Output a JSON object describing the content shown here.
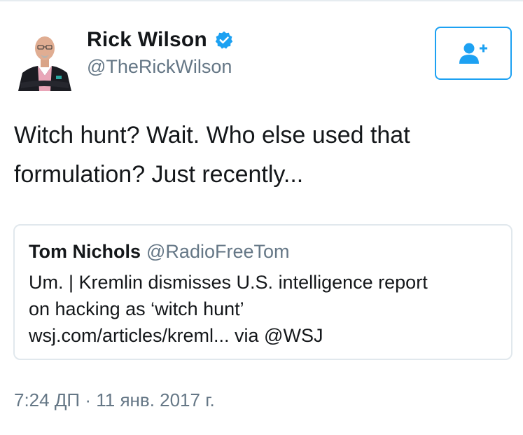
{
  "author": {
    "display_name": "Rick Wilson",
    "handle": "@TheRickWilson",
    "verified_icon": "verified-badge-icon"
  },
  "follow_button": {
    "icon": "add-user-icon"
  },
  "tweet": {
    "lines": [
      "Witch hunt? Wait. Who else used that",
      "formulation? Just recently..."
    ]
  },
  "quoted_tweet": {
    "author_name": "Tom Nichols",
    "author_handle": "@RadioFreeTom",
    "lines": [
      "Um. | Kremlin dismisses U.S. intelligence report",
      "on hacking as ‘witch hunt’",
      "wsj.com/articles/kreml... via @WSJ"
    ]
  },
  "timestamp": "7:24 ДП · 11 янв. 2017 г.",
  "colors": {
    "accent": "#1da1f2",
    "secondary_text": "#657786",
    "border": "#e1e8ed"
  }
}
